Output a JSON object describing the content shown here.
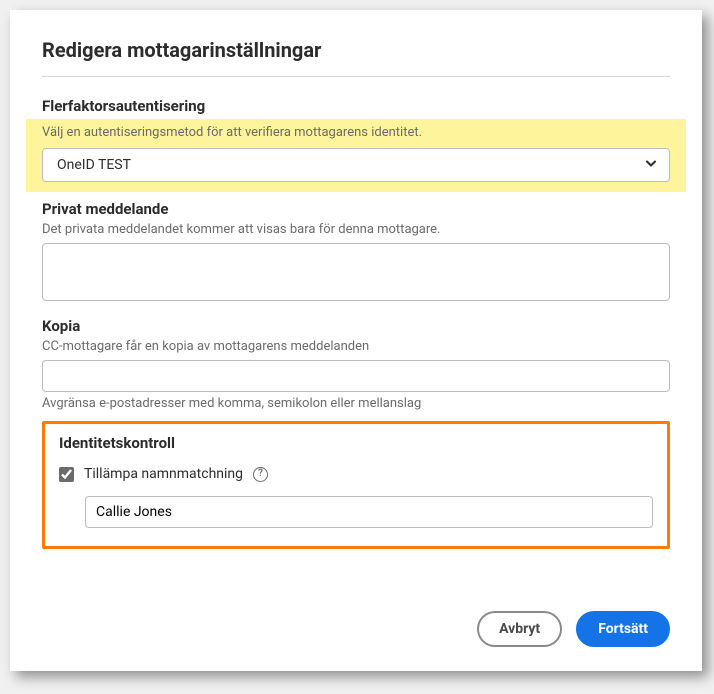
{
  "dialog": {
    "title": "Redigera mottagarinställningar"
  },
  "mfa": {
    "header": "Flerfaktorsautentisering",
    "hint": "Välj en autentiseringsmetod för att verifiera mottagarens identitet.",
    "selected": "OneID TEST"
  },
  "privateMessage": {
    "header": "Privat meddelande",
    "hint": "Det privata meddelandet kommer att visas bara för denna mottagare.",
    "value": ""
  },
  "copy": {
    "header": "Kopia",
    "hint": "CC-mottagare får en kopia av mottagarens meddelanden",
    "value": "",
    "hintBelow": "Avgränsa e-postadresser med komma, semikolon eller mellanslag"
  },
  "identity": {
    "header": "Identitetskontroll",
    "checkboxLabel": "Tillämpa namnmatchning",
    "checked": true,
    "nameValue": "Callie Jones"
  },
  "footer": {
    "cancel": "Avbryt",
    "continue": "Fortsätt"
  }
}
